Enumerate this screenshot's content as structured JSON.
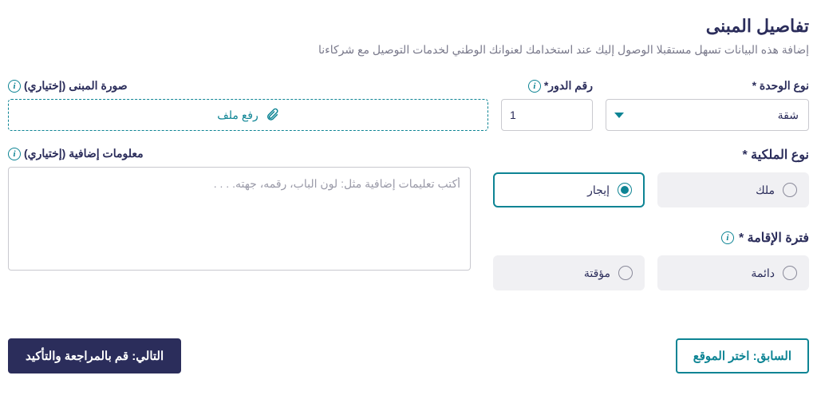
{
  "heading": {
    "title": "تفاصيل المبنى",
    "subtitle": "إضافة هذه البيانات تسهل مستقبلا الوصول إليك عند استخدامك لعنوانك الوطني لخدمات التوصيل مع شركاءنا"
  },
  "fields": {
    "unit_type": {
      "label": "نوع الوحدة *",
      "value": "شقة"
    },
    "floor": {
      "label": "رقم الدور*",
      "value": "1"
    },
    "photo": {
      "label": "صورة المبنى (إختياري)",
      "upload_text": "رفع ملف"
    },
    "extra_info": {
      "label": "معلومات إضافية (إختياري)",
      "placeholder": "أكتب تعليمات إضافية مثل: لون الباب، رقمه، جهته. . . ."
    }
  },
  "ownership": {
    "label": "نوع الملكية *",
    "options": {
      "own": "ملك",
      "rent": "إيجار"
    },
    "selected": "rent"
  },
  "stay": {
    "label": "فترة الإقامة *",
    "options": {
      "permanent": "دائمة",
      "temporary": "مؤقتة"
    },
    "selected": ""
  },
  "nav": {
    "prev": "السابق: اختر الموقع",
    "next": "التالي: قم بالمراجعة والتأكيد"
  }
}
